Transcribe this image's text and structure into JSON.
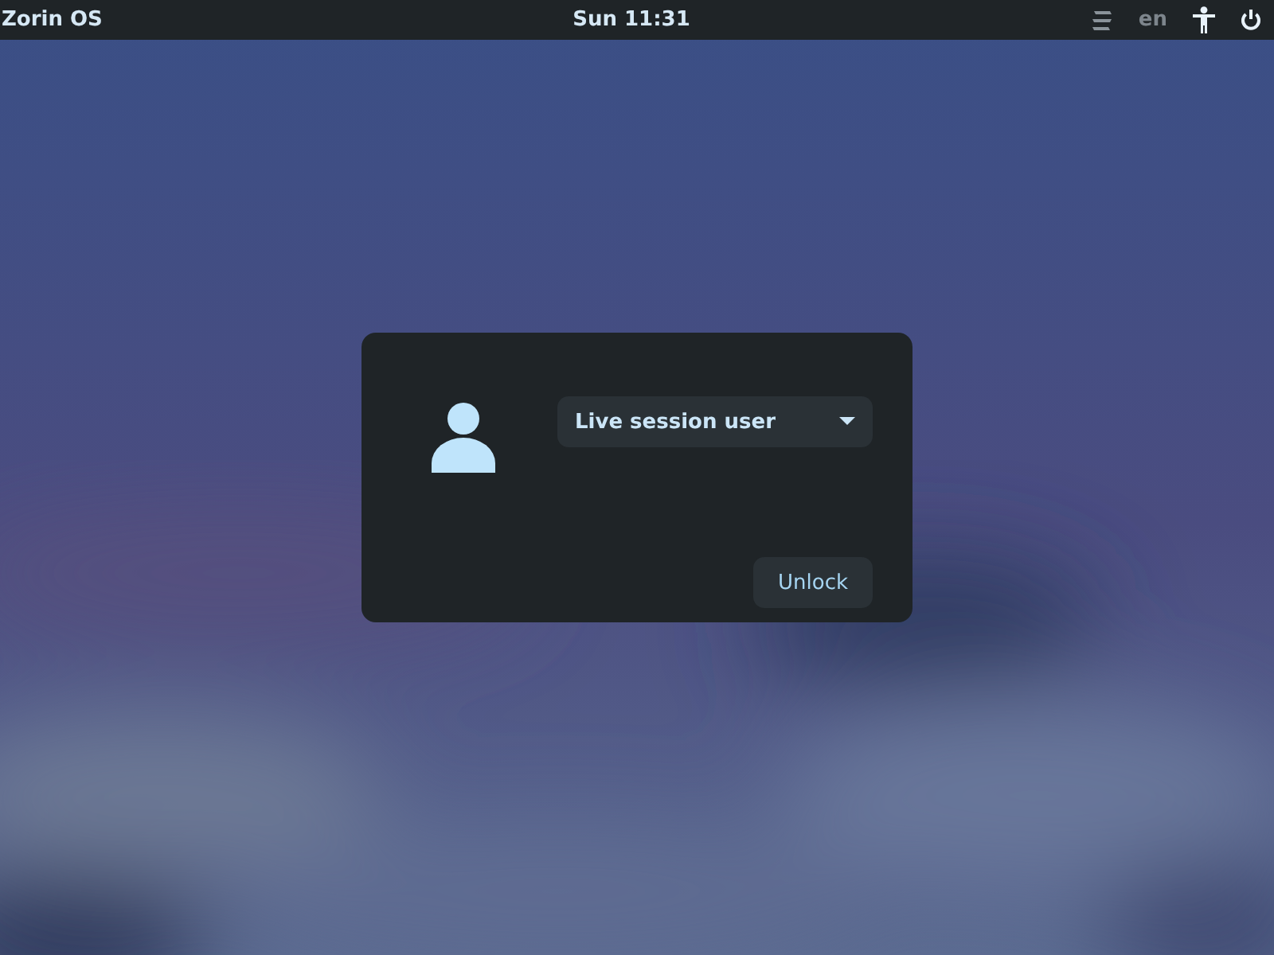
{
  "top_bar": {
    "activities": "Zorin OS",
    "clock": "Sun 11:31",
    "language": "en"
  },
  "unlock_dialog": {
    "user": "Live session user",
    "unlock_button": "Unlock"
  }
}
